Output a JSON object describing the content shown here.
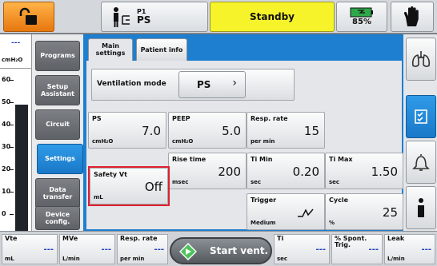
{
  "top_bar": {
    "patient_label": "P1",
    "patient_mode": "PS",
    "status": "Standby",
    "battery": "85%"
  },
  "gauge": {
    "unit": "cmH₂O",
    "value": "---",
    "ticks": [
      "60",
      "50",
      "40",
      "30",
      "20",
      "10",
      "0"
    ]
  },
  "nav": {
    "items": [
      "Programs",
      "Setup Assistant",
      "Circuit",
      "Settings",
      "Data transfer",
      "Device config."
    ],
    "active": "Settings"
  },
  "tabs": [
    {
      "label": "Main settings",
      "active": true
    },
    {
      "label": "Patient info",
      "active": false
    }
  ],
  "ventilation_mode": {
    "label": "Ventilation mode",
    "value": "PS"
  },
  "settings": [
    {
      "name": "PS",
      "value": "7.0",
      "unit": "cmH₂O"
    },
    {
      "name": "PEEP",
      "value": "5.0",
      "unit": "cmH₂O"
    },
    {
      "name": "Resp. rate",
      "value": "15",
      "unit": "per min"
    },
    {
      "name": "Rise time",
      "value": "200",
      "unit": "msec"
    },
    {
      "name": "Ti Min",
      "value": "0.20",
      "unit": "sec"
    },
    {
      "name": "Ti Max",
      "value": "1.50",
      "unit": "sec"
    },
    {
      "name": "Safety Vt",
      "value": "Off",
      "unit": "mL"
    },
    {
      "name": "Trigger",
      "value": "",
      "unit": "Medium",
      "icon": "trigger-curve-icon"
    },
    {
      "name": "Cycle",
      "value": "25",
      "unit": "%"
    }
  ],
  "right_bar": {
    "buttons": [
      "lungs-icon",
      "checklist-icon",
      "bell-icon",
      "info-icon"
    ],
    "active": "checklist-icon"
  },
  "bottom_bar": {
    "monitors": [
      {
        "name": "Vte",
        "unit": "mL",
        "value": "---"
      },
      {
        "name": "MVe",
        "unit": "L/min",
        "value": "---"
      },
      {
        "name": "Resp. rate",
        "unit": "per min",
        "value": "---"
      },
      {
        "name": "Ti",
        "unit": "sec",
        "value": "---"
      },
      {
        "name": "% Spont. Trig.",
        "unit": "",
        "value": "---"
      },
      {
        "name": "Leak",
        "unit": "L/min",
        "value": "---"
      }
    ],
    "start_button": "Start vent."
  },
  "colors": {
    "accent": "#1e7fd0",
    "standby": "#f6f32a",
    "lock": "#f08c1e",
    "highlight": "#e0202e",
    "value_dash": "#2040c0"
  }
}
